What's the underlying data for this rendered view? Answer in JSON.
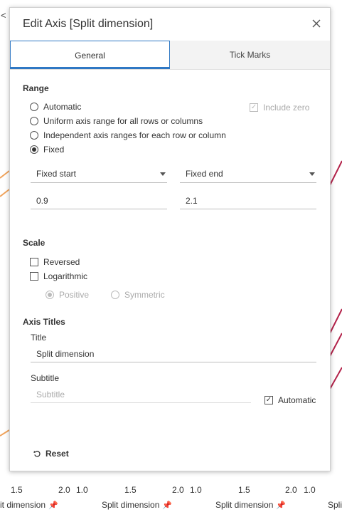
{
  "background": {
    "left_marker": "<",
    "tick_labels": [
      "1.5",
      "2.0",
      "1.0",
      "1.5",
      "2.0",
      "1.0",
      "1.5",
      "2.0",
      "1.0"
    ],
    "dimension_labels": [
      "it dimension",
      "Split dimension",
      "Split dimension",
      "Spli"
    ],
    "colors": {
      "orange": "#f0a35b",
      "crimson": "#b3224a"
    }
  },
  "dialog": {
    "title": "Edit Axis [Split dimension]",
    "tabs": [
      {
        "label": "General",
        "active": true
      },
      {
        "label": "Tick Marks",
        "active": false
      }
    ],
    "range": {
      "heading": "Range",
      "options": [
        "Automatic",
        "Uniform axis range for all rows or columns",
        "Independent axis ranges for each row or column",
        "Fixed"
      ],
      "selected": "Fixed",
      "include_zero": "Include zero",
      "start_mode": "Fixed start",
      "end_mode": "Fixed end",
      "start_value": "0.9",
      "end_value": "2.1"
    },
    "scale": {
      "heading": "Scale",
      "reversed": "Reversed",
      "logarithmic": "Logarithmic",
      "positive": "Positive",
      "symmetric": "Symmetric"
    },
    "axis_titles": {
      "heading": "Axis Titles",
      "title_label": "Title",
      "title_value": "Split dimension",
      "subtitle_label": "Subtitle",
      "subtitle_placeholder": "Subtitle",
      "automatic": "Automatic",
      "automatic_checked": true
    },
    "reset_label": "Reset",
    "accent_color": "#2f78c4"
  }
}
